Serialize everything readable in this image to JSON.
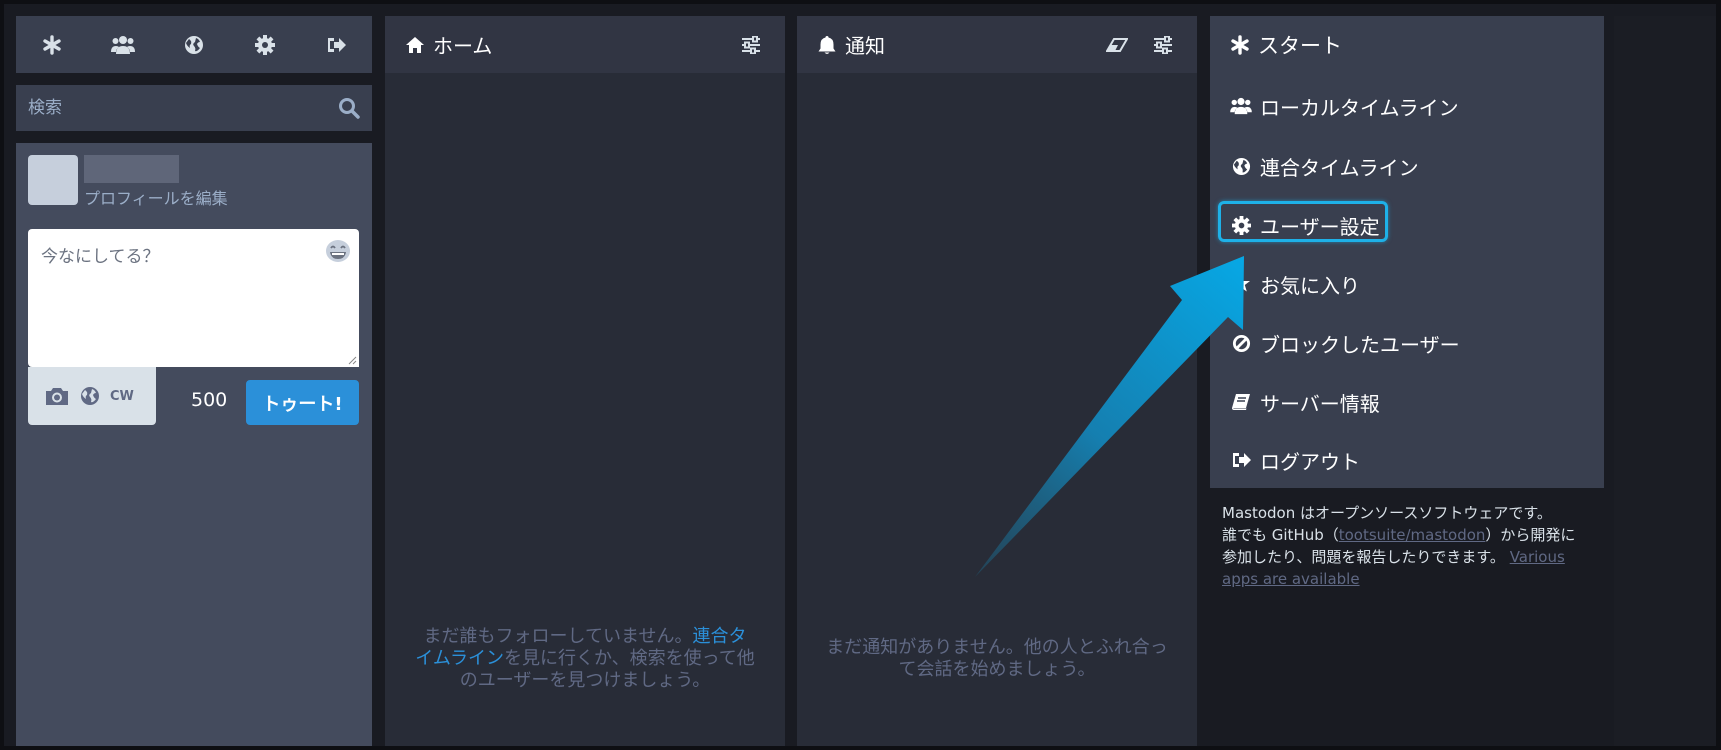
{
  "drawer": {
    "tabs": [
      {
        "name": "start-tab",
        "icon": "asterisk-icon"
      },
      {
        "name": "local-timeline-tab",
        "icon": "users-icon"
      },
      {
        "name": "federated-timeline-tab",
        "icon": "globe-icon"
      },
      {
        "name": "settings-tab",
        "icon": "gear-icon"
      },
      {
        "name": "logout-tab",
        "icon": "sign-out-icon"
      }
    ],
    "search_placeholder": "検索"
  },
  "composer": {
    "edit_profile": "プロフィールを編集",
    "placeholder": "今なにしてる？",
    "cw_label": "CW",
    "counter": "500",
    "submit_label": "トゥート!"
  },
  "home": {
    "title": "ホーム",
    "empty_prefix": "まだ誰もフォローしていません。",
    "empty_link": "連合タイムライン",
    "empty_suffix": "を見に行くか、検索を使って他のユーザーを見つけましょう。"
  },
  "notifications": {
    "title": "通知",
    "empty": "まだ通知がありません。他の人とふれ合って会話を始めましょう。"
  },
  "start": {
    "title": "スタート",
    "items": [
      {
        "label": "ローカルタイムライン",
        "icon": "users-icon"
      },
      {
        "label": "連合タイムライン",
        "icon": "globe-icon"
      },
      {
        "label": "ユーザー設定",
        "icon": "gear-icon"
      },
      {
        "label": "お気に入り",
        "icon": "star-icon"
      },
      {
        "label": "ブロックしたユーザー",
        "icon": "ban-icon"
      },
      {
        "label": "サーバー情報",
        "icon": "book-icon"
      },
      {
        "label": "ログアウト",
        "icon": "sign-out-icon"
      }
    ],
    "footer": {
      "line1": "Mastodon はオープンソースソフトウェアです。",
      "line2_prefix": "誰でも GitHub（",
      "line2_link": "tootsuite/mastodon",
      "line2_suffix": "）から開発に",
      "line3": "参加したり、問題を報告したりできます。",
      "apps_link": "Various apps are available"
    }
  },
  "colors": {
    "accent": "#2b90d9",
    "highlight": "#1eb1e8",
    "column_bg": "#282c37",
    "header_bg": "#313543",
    "drawer_bg": "#444b5d"
  }
}
